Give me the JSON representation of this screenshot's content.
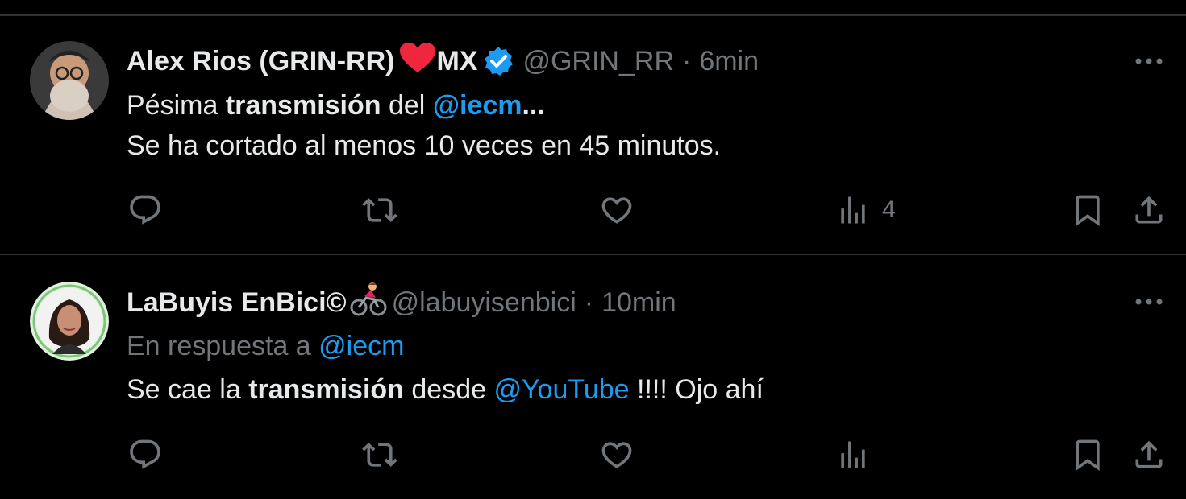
{
  "tweets": [
    {
      "display_name": "Alex Rios (GRIN-RR)",
      "name_suffix": "MX",
      "handle": "@GRIN_RR",
      "separator": "·",
      "time": "6min",
      "verified": true,
      "body": {
        "l1_a": "Pésima ",
        "l1_b": "transmisión",
        "l1_c": " del ",
        "l1_link": "@iecm",
        "l1_d": "...",
        "l2": "Se ha cortado al menos 10 veces en 45 minutos."
      },
      "actions": {
        "reply_icon": "reply-icon",
        "retweet_icon": "retweet-icon",
        "like_icon": "heart-icon",
        "views_icon": "views-icon",
        "views_count": "4",
        "bookmark_icon": "bookmark-icon",
        "share_icon": "share-icon"
      }
    },
    {
      "display_name": "LaBuyis EnBici©",
      "handle": "@labuyisenbici",
      "separator": "·",
      "time": "10min",
      "reply_to_label": "En respuesta a ",
      "reply_to_handle": "@iecm",
      "body": {
        "a": "Se cae la ",
        "b": "transmisión",
        "c": " desde ",
        "link": "@YouTube",
        "d": " !!!! Ojo ahí"
      },
      "actions": {
        "reply_icon": "reply-icon",
        "retweet_icon": "retweet-icon",
        "like_icon": "heart-icon",
        "views_icon": "views-icon",
        "bookmark_icon": "bookmark-icon",
        "share_icon": "share-icon"
      }
    }
  ],
  "colors": {
    "background": "#000000",
    "text": "#e7e9ea",
    "muted": "#71767b",
    "link": "#1d9bf0",
    "divider": "#2f3336",
    "heart": "#f91880",
    "verified": "#1d9bf0"
  }
}
